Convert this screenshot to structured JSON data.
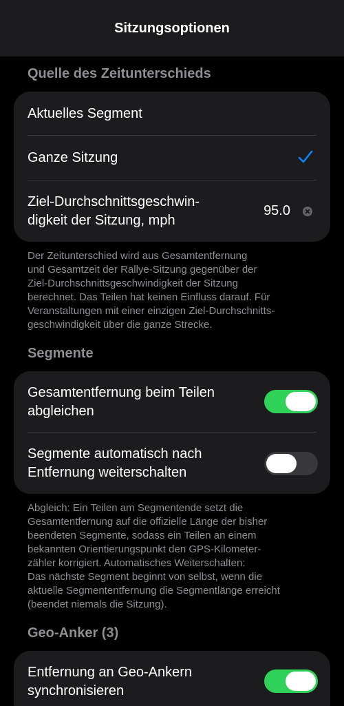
{
  "nav": {
    "title": "Sitzungsoptionen"
  },
  "sections": {
    "time_source": {
      "header": "Quelle des Zeitunterschieds",
      "option_segment": "Aktuelles Segment",
      "option_session": "Ganze Sitzung",
      "target_label_line1": "Ziel-Durchschnittsgeschwin-",
      "target_label_line2": "digkeit der Sitzung, mph",
      "target_value": "95.0",
      "footer_lines": [
        "Der Zeitunterschied wird aus Gesamtentfernung",
        "und Gesamtzeit der Rallye-Sitzung gegenüber der",
        "Ziel-Durchschnittsgeschwindigkeit der Sitzung",
        "berechnet. Das Teilen hat keinen Einfluss darauf. Für",
        "Veranstaltungen mit einer einzigen Ziel-Durchschnitts-",
        "geschwindigkeit über die ganze Strecke."
      ]
    },
    "segments": {
      "header": "Segmente",
      "row1_line1": "Gesamtentfernung beim Teilen",
      "row1_line2": "abgleichen",
      "row1_on": true,
      "row2_line1": "Segmente automatisch nach",
      "row2_line2": "Entfernung weiterschalten",
      "row2_on": false,
      "footer_lines": [
        "Abgleich: Ein Teilen am Segmentende setzt die",
        "Gesamtentfernung auf die offizielle Länge der bisher",
        "beendeten Segmente, sodass ein Teilen an einem",
        "bekannten Orientierungspunkt den GPS-Kilometer-",
        "zähler korrigiert. Automatisches Weiterschalten:",
        "Das nächste Segment beginnt von selbst, wenn die",
        "aktuelle Segmententfernung die Segmentlänge erreicht",
        "(beendet niemals die Sitzung)."
      ]
    },
    "geo": {
      "header": "Geo-Anker (3)",
      "row1_line1": "Entfernung an Geo-Ankern",
      "row1_line2": "synchronisieren",
      "row1_on": true
    }
  },
  "colors": {
    "accent": "#0a84ff",
    "toggle_on": "#30d158",
    "card": "#1c1c1e"
  }
}
